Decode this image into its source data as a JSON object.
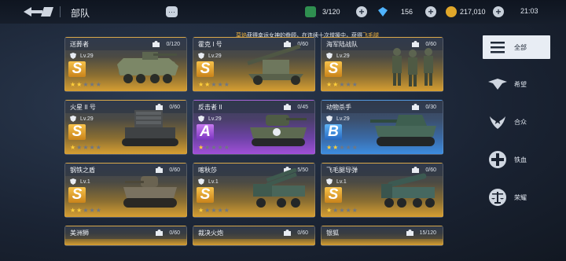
{
  "header": {
    "title": "部队",
    "chat_icon": "chat-bubble-icon",
    "resources": [
      {
        "name": "flag-icon",
        "value": "3/120",
        "color": "#3aa35a"
      },
      {
        "name": "diamond-icon",
        "value": "156",
        "color": "#4fb3ff"
      },
      {
        "name": "coin-icon",
        "value": "217,010",
        "color": "#e0a72a"
      }
    ],
    "clock": "21:03"
  },
  "notice": {
    "player": "莫焰",
    "text": "获得幸运女神的眷顾，在连续十次增援中，获得",
    "reward": "飞毛腿"
  },
  "units": [
    {
      "name": "送葬者",
      "fragments": "0/120",
      "level": "Lv.29",
      "grade": "S",
      "stars": 2,
      "theme": "gold"
    },
    {
      "name": "霍克 I 号",
      "fragments": "0/60",
      "level": "Lv.29",
      "grade": "S",
      "stars": 2,
      "theme": "gold"
    },
    {
      "name": "海军陆战队",
      "fragments": "0/60",
      "level": "Lv.29",
      "grade": "S",
      "stars": 2,
      "theme": "gold"
    },
    {
      "name": "火星 II 号",
      "fragments": "0/60",
      "level": "Lv.29",
      "grade": "S",
      "stars": 1,
      "theme": "gold"
    },
    {
      "name": "反击者 II",
      "fragments": "0/45",
      "level": "Lv.29",
      "grade": "A",
      "stars": 1,
      "theme": "purple"
    },
    {
      "name": "动物杀手",
      "fragments": "0/30",
      "level": "Lv.29",
      "grade": "B",
      "stars": 2,
      "theme": "blue"
    },
    {
      "name": "钢铁之盾",
      "fragments": "0/60",
      "level": "Lv.1",
      "grade": "S",
      "stars": 2,
      "theme": "gold"
    },
    {
      "name": "喀秋莎",
      "fragments": "5/50",
      "level": "Lv.1",
      "grade": "S",
      "stars": 1,
      "theme": "gold"
    },
    {
      "name": "飞毛腿导弹",
      "fragments": "0/60",
      "level": "Lv.1",
      "grade": "S",
      "stars": 1,
      "theme": "gold"
    },
    {
      "name": "美洲狮",
      "fragments": "0/60"
    },
    {
      "name": "裁决火炮",
      "fragments": "0/60"
    },
    {
      "name": "银狐",
      "fragments": "15/120"
    }
  ],
  "sidebar": {
    "items": [
      {
        "label": "全部",
        "icon": "menu-lines-icon",
        "active": true
      },
      {
        "label": "希望",
        "icon": "eagle-emblem-icon",
        "active": false
      },
      {
        "label": "合众",
        "icon": "star-wings-emblem-icon",
        "active": false
      },
      {
        "label": "铁血",
        "icon": "iron-cross-emblem-icon",
        "active": false
      },
      {
        "label": "荣耀",
        "icon": "scales-emblem-icon",
        "active": false
      }
    ]
  }
}
